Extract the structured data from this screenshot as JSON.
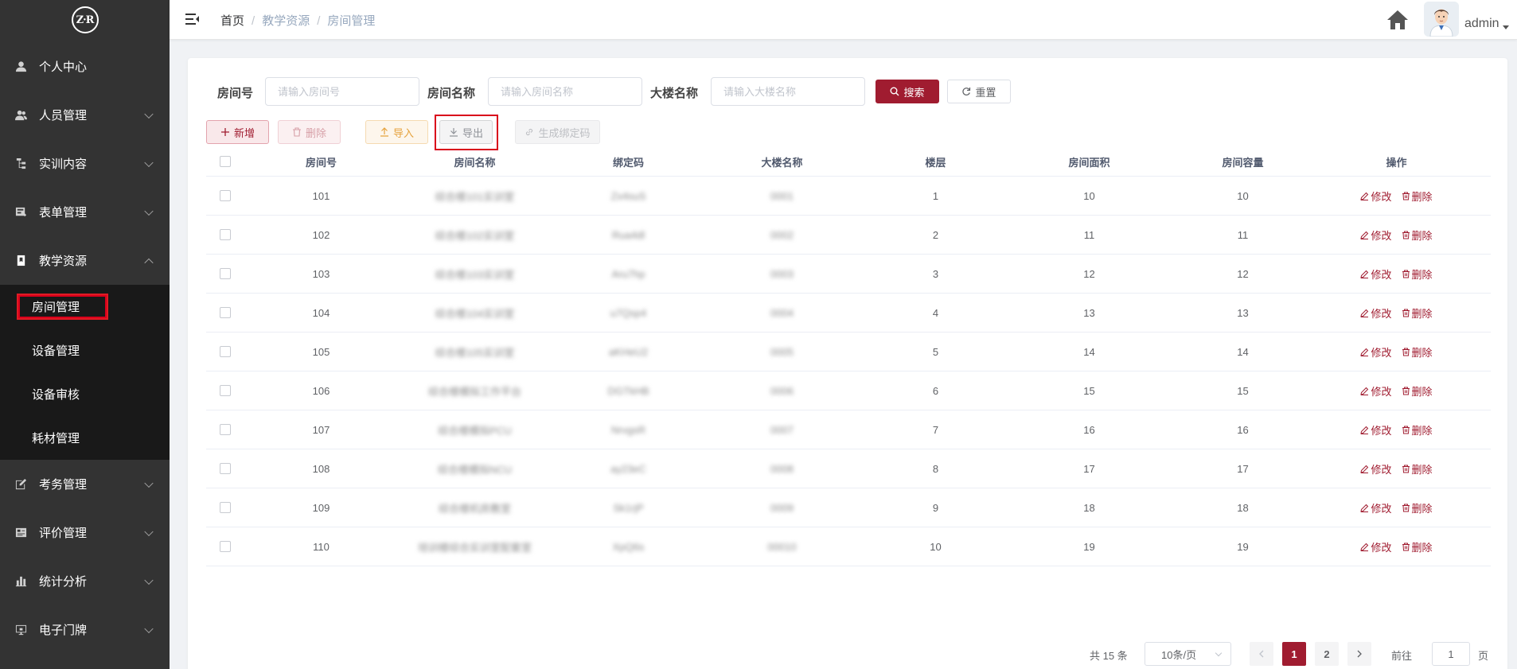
{
  "sidebar": {
    "logo_text": "Z·R",
    "menu": [
      {
        "label": "个人中心",
        "icon": "user-icon"
      },
      {
        "label": "人员管理",
        "icon": "users-icon"
      },
      {
        "label": "实训内容",
        "icon": "tree-icon"
      },
      {
        "label": "表单管理",
        "icon": "form-icon"
      },
      {
        "label": "教学资源",
        "icon": "book-icon"
      },
      {
        "label": "考务管理",
        "icon": "edit-icon"
      },
      {
        "label": "评价管理",
        "icon": "rating-icon"
      },
      {
        "label": "统计分析",
        "icon": "bar-chart-icon"
      },
      {
        "label": "电子门牌",
        "icon": "monitor-icon"
      }
    ],
    "submenu": [
      {
        "label": "房间管理"
      },
      {
        "label": "设备管理"
      },
      {
        "label": "设备审核"
      },
      {
        "label": "耗材管理"
      }
    ]
  },
  "header": {
    "breadcrumb": [
      "首页",
      "教学资源",
      "房间管理"
    ],
    "username": "admin"
  },
  "search": {
    "room_no_label": "房间号",
    "room_no_placeholder": "请输入房间号",
    "room_name_label": "房间名称",
    "room_name_placeholder": "请输入房间名称",
    "building_label": "大楼名称",
    "building_placeholder": "请输入大楼名称",
    "search_btn": "搜索",
    "reset_btn": "重置"
  },
  "toolbar": {
    "add": "新增",
    "delete": "删除",
    "import": "导入",
    "export": "导出",
    "gen_code": "生成绑定码"
  },
  "table": {
    "headers": [
      "房间号",
      "房间名称",
      "绑定码",
      "大楼名称",
      "楼层",
      "房间面积",
      "房间容量",
      "操作"
    ],
    "edit_label": "修改",
    "delete_label": "删除",
    "rows": [
      {
        "room_no": "101",
        "name": "综合楼101实训室",
        "code": "Zx4suS",
        "building": "0001",
        "floor": "1",
        "area": "10",
        "capacity": "10"
      },
      {
        "room_no": "102",
        "name": "综合楼102实训室",
        "code": "Rua4dl",
        "building": "0002",
        "floor": "2",
        "area": "11",
        "capacity": "11"
      },
      {
        "room_no": "103",
        "name": "综合楼103实训室",
        "code": "Aru7hp",
        "building": "0003",
        "floor": "3",
        "area": "12",
        "capacity": "12"
      },
      {
        "room_no": "104",
        "name": "综合楼104实训室",
        "code": "u7Qsp4",
        "building": "0004",
        "floor": "4",
        "area": "13",
        "capacity": "13"
      },
      {
        "room_no": "105",
        "name": "综合楼105实训室",
        "code": "aKHeU2",
        "building": "0005",
        "floor": "5",
        "area": "14",
        "capacity": "14"
      },
      {
        "room_no": "106",
        "name": "综合楼模拟工作平台",
        "code": "DGTkHB",
        "building": "0006",
        "floor": "6",
        "area": "15",
        "capacity": "15"
      },
      {
        "room_no": "107",
        "name": "综合楼模拟PCU",
        "code": "NrvgsR",
        "building": "0007",
        "floor": "7",
        "area": "16",
        "capacity": "16"
      },
      {
        "room_no": "108",
        "name": "综合楼模拟NCU",
        "code": "ay23eC",
        "building": "0008",
        "floor": "8",
        "area": "17",
        "capacity": "17"
      },
      {
        "room_no": "109",
        "name": "综合楼机房教室",
        "code": "Sk1rjP",
        "building": "0009",
        "floor": "9",
        "area": "18",
        "capacity": "18"
      },
      {
        "room_no": "110",
        "name": "培训楼综合实训室配套室",
        "code": "XpQ6s",
        "building": "00010",
        "floor": "10",
        "area": "19",
        "capacity": "19"
      }
    ]
  },
  "pagination": {
    "total": "共 15 条",
    "page_size": "10条/页",
    "pages": [
      "1",
      "2"
    ],
    "goto_label": "前往",
    "current": "1",
    "page_suffix": "页"
  },
  "colors": {
    "accent": "#a01c30",
    "sidebar_bg": "#333333",
    "submenu_bg": "#191919",
    "highlight_box": "#d9001b"
  }
}
